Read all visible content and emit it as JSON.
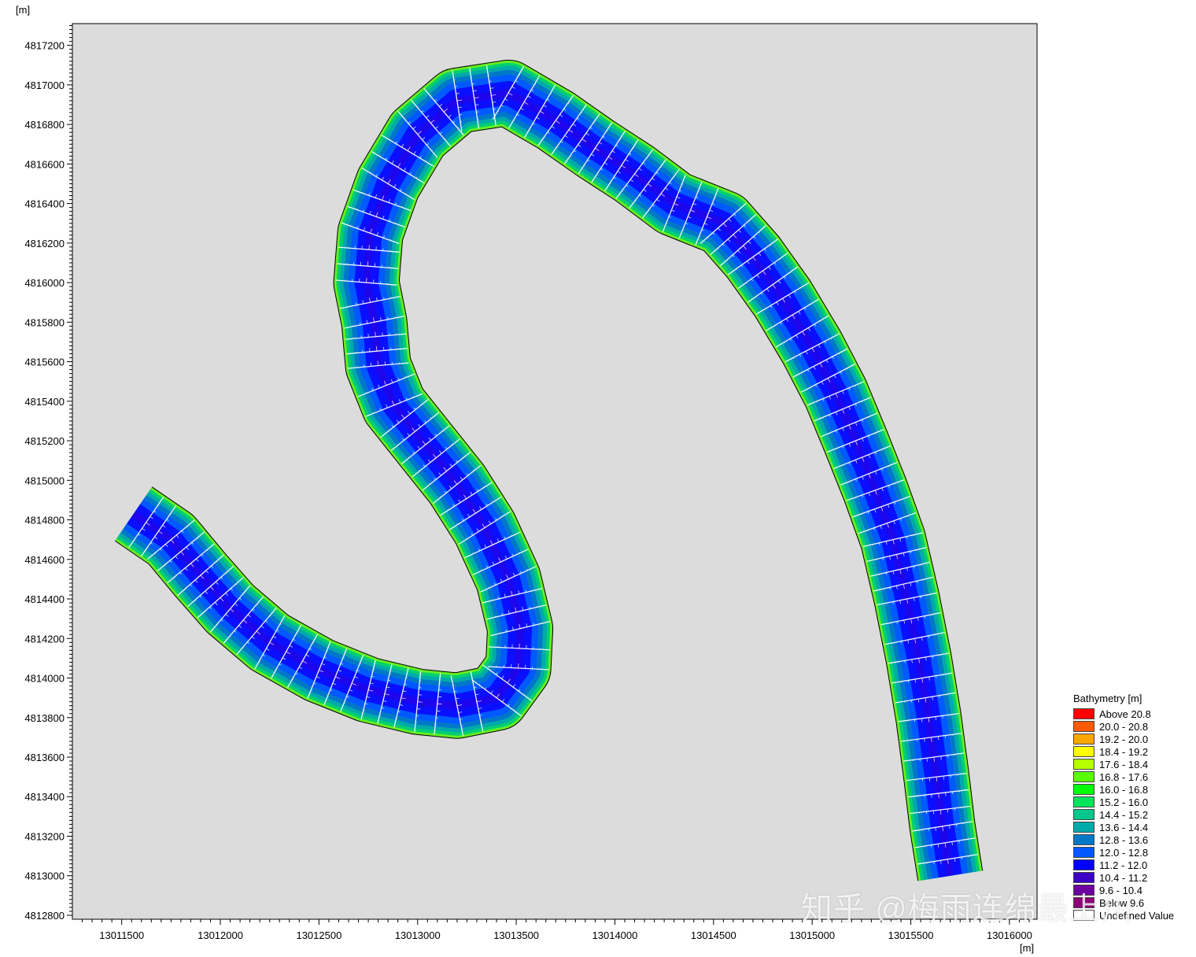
{
  "axes": {
    "y_unit": "[m]",
    "x_unit": "[m]",
    "x_ticks": [
      "13011500",
      "13012000",
      "13012500",
      "13013000",
      "13013500",
      "13014000",
      "13014500",
      "13015000",
      "13015500",
      "13016000"
    ],
    "y_ticks": [
      "4817200",
      "4817000",
      "4816800",
      "4816600",
      "4816400",
      "4816200",
      "4816000",
      "4815800",
      "4815600",
      "4815400",
      "4815200",
      "4815000",
      "4814800",
      "4814600",
      "4814400",
      "4814200",
      "4814000",
      "4813800",
      "4813600",
      "4813400",
      "4813200",
      "4813000",
      "4812800"
    ],
    "xlim": [
      13011250,
      13016140
    ],
    "ylim": [
      4812780,
      4817310
    ]
  },
  "legend": {
    "title": "Bathymetry [m]",
    "items": [
      {
        "label": "Above 20.8",
        "color": "#ff0000"
      },
      {
        "label": "20.0 - 20.8",
        "color": "#ff5a00"
      },
      {
        "label": "19.2 - 20.0",
        "color": "#ffa500"
      },
      {
        "label": "18.4 - 19.2",
        "color": "#ffff00"
      },
      {
        "label": "17.6 - 18.4",
        "color": "#b4ff00"
      },
      {
        "label": "16.8 - 17.6",
        "color": "#5aff00"
      },
      {
        "label": "16.0 - 16.8",
        "color": "#00ff00"
      },
      {
        "label": "15.2 - 16.0",
        "color": "#00e65a"
      },
      {
        "label": "14.4 - 15.2",
        "color": "#00c88c"
      },
      {
        "label": "13.6 - 14.4",
        "color": "#00aaaa"
      },
      {
        "label": "12.8 - 13.6",
        "color": "#0078c8"
      },
      {
        "label": "12.0 - 12.8",
        "color": "#005aff"
      },
      {
        "label": "11.2 - 12.0",
        "color": "#0000ff"
      },
      {
        "label": "10.4 - 11.2",
        "color": "#3c00c8"
      },
      {
        "label": "9.6 - 10.4",
        "color": "#6e00a0"
      },
      {
        "label": "Below 9.6",
        "color": "#8c0078"
      },
      {
        "label": "Undefined Value",
        "color": "#ffffff"
      }
    ]
  },
  "chart_data": {
    "type": "map",
    "centerline": [
      [
        13011560,
        4814830
      ],
      [
        13011750,
        4814700
      ],
      [
        13011900,
        4814520
      ],
      [
        13012050,
        4814350
      ],
      [
        13012250,
        4814180
      ],
      [
        13012500,
        4814040
      ],
      [
        13012750,
        4813940
      ],
      [
        13013000,
        4813880
      ],
      [
        13013200,
        4813860
      ],
      [
        13013400,
        4813900
      ],
      [
        13013510,
        4814050
      ],
      [
        13013520,
        4814250
      ],
      [
        13013460,
        4814500
      ],
      [
        13013340,
        4814760
      ],
      [
        13013200,
        4814980
      ],
      [
        13013040,
        4815180
      ],
      [
        13012880,
        4815380
      ],
      [
        13012800,
        4815580
      ],
      [
        13012780,
        4815800
      ],
      [
        13012740,
        4816000
      ],
      [
        13012760,
        4816250
      ],
      [
        13012850,
        4816500
      ],
      [
        13013000,
        4816750
      ],
      [
        13013200,
        4816920
      ],
      [
        13013460,
        4816960
      ],
      [
        13013700,
        4816820
      ],
      [
        13013900,
        4816680
      ],
      [
        13014100,
        4816550
      ],
      [
        13014300,
        4816400
      ],
      [
        13014550,
        4816300
      ],
      [
        13014700,
        4816130
      ],
      [
        13014850,
        4815920
      ],
      [
        13015000,
        4815670
      ],
      [
        13015120,
        4815440
      ],
      [
        13015220,
        4815200
      ],
      [
        13015320,
        4814950
      ],
      [
        13015410,
        4814700
      ],
      [
        13015480,
        4814400
      ],
      [
        13015540,
        4814100
      ],
      [
        13015590,
        4813800
      ],
      [
        13015630,
        4813500
      ],
      [
        13015660,
        4813250
      ],
      [
        13015700,
        4813000
      ]
    ],
    "watermark": "知乎 @梅雨连绵最上川"
  }
}
